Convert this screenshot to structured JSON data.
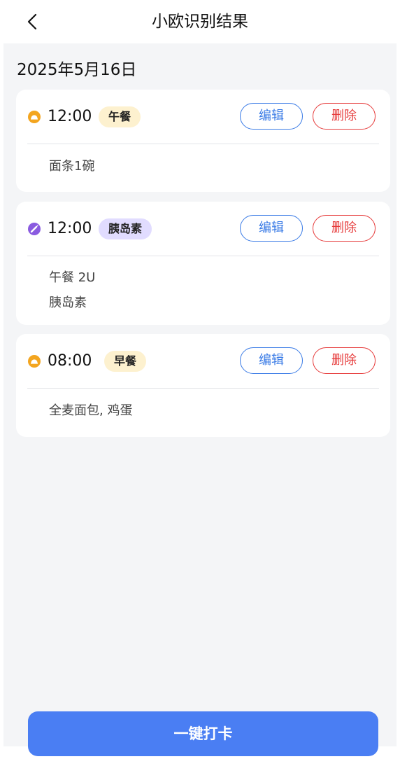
{
  "header": {
    "title": "小欧识别结果",
    "back_icon": "chevron-left-icon"
  },
  "date": "2025年5月16日",
  "records": [
    {
      "time": "12:00",
      "tag": "午餐",
      "tag_type": "meal",
      "icon": "meal-icon",
      "edit_label": "编辑",
      "delete_label": "删除",
      "lines": [
        "面条1碗"
      ]
    },
    {
      "time": "12:00",
      "tag": "胰岛素",
      "tag_type": "insulin",
      "icon": "insulin-pen-icon",
      "edit_label": "编辑",
      "delete_label": "删除",
      "lines": [
        "午餐 2U",
        "胰岛素"
      ]
    },
    {
      "time": "08:00",
      "tag": "早餐",
      "tag_type": "meal",
      "icon": "meal-icon",
      "edit_label": "编辑",
      "delete_label": "删除",
      "lines": [
        "全麦面包, 鸡蛋"
      ]
    }
  ],
  "footer": {
    "button_label": "一键打卡"
  },
  "colors": {
    "accent": "#4a7ef3",
    "edit": "#3a7be6",
    "delete": "#e63b3b",
    "meal_tag": "#fdf1cf",
    "insulin_tag": "#e1dcff"
  }
}
